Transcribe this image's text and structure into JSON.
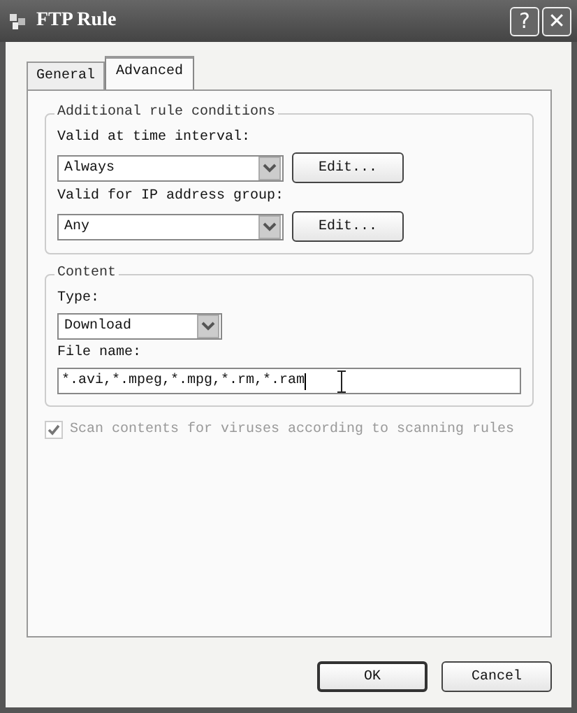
{
  "window": {
    "title": "FTP Rule"
  },
  "title_buttons": [
    {
      "label": "?"
    },
    {
      "label": "✕"
    }
  ],
  "tabs": [
    {
      "label": "General",
      "selected": false
    },
    {
      "label": "Advanced",
      "selected": true
    }
  ],
  "groups": [
    {
      "title": "Additional rule conditions",
      "fields": [
        {
          "kind": "combo",
          "label": "Valid at time interval:",
          "value": "Always",
          "button": "Edit..."
        },
        {
          "kind": "combo",
          "label": "Valid for IP address group:",
          "value": "Any",
          "button": "Edit..."
        }
      ]
    },
    {
      "title": "Content",
      "fields": [
        {
          "kind": "select",
          "label": "Type:",
          "value": "Download"
        },
        {
          "kind": "text",
          "label": "File name:",
          "value": "*.avi,*.mpeg,*.mpg,*.rm,*.ram",
          "focused": true
        }
      ]
    }
  ],
  "scan_checkbox": {
    "label": "Scan contents for viruses according to scanning rules",
    "checked": true,
    "disabled": true
  },
  "buttons": [
    {
      "label": "OK",
      "default": true
    },
    {
      "label": "Cancel",
      "default": false
    }
  ]
}
